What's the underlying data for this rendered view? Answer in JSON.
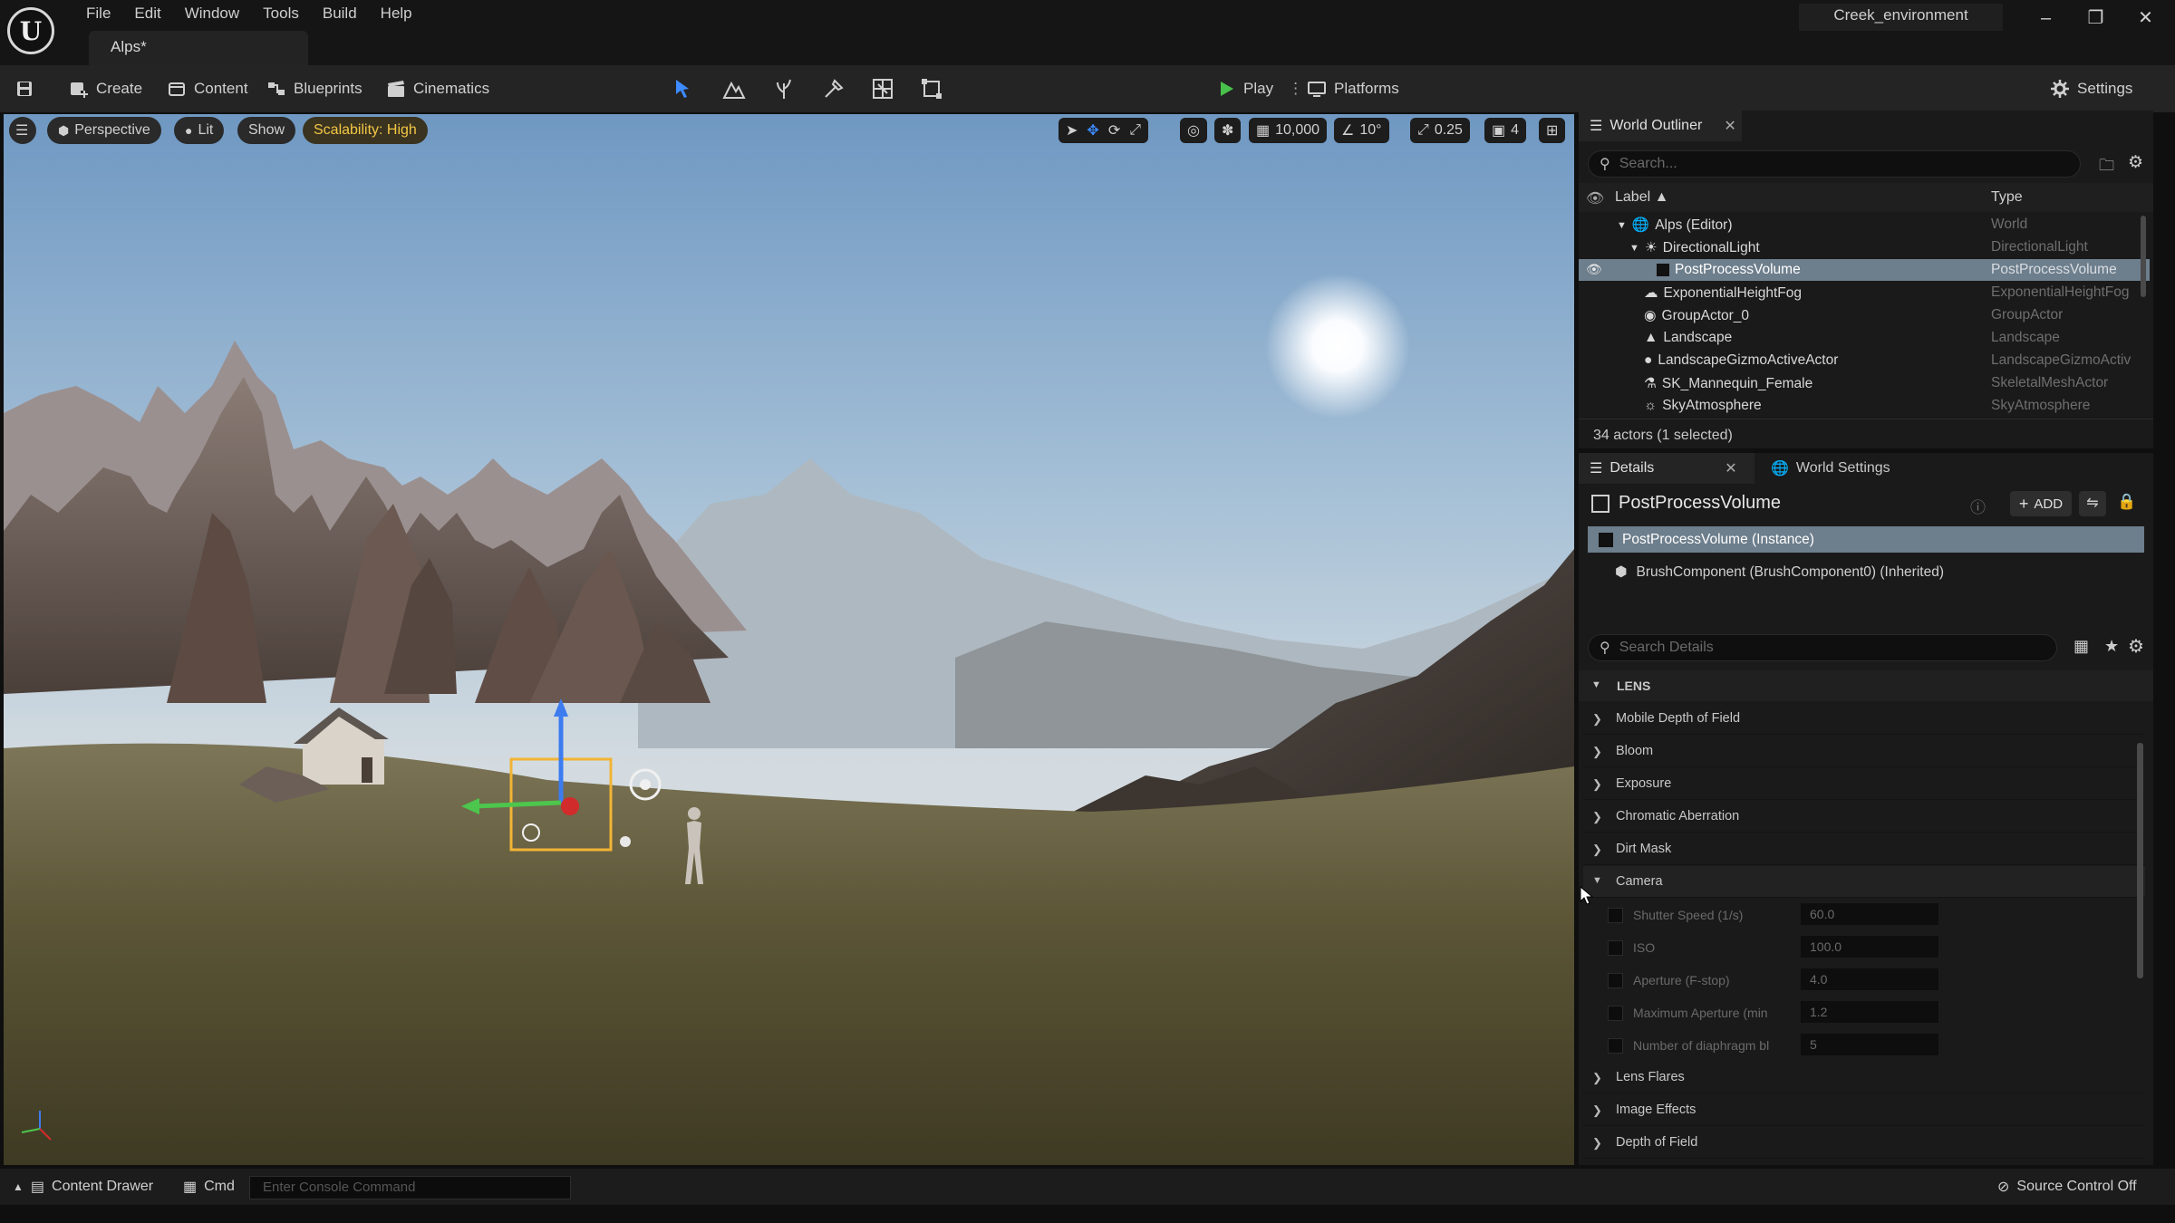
{
  "app": {
    "logo_text": "U",
    "menu": [
      "File",
      "Edit",
      "Window",
      "Tools",
      "Build",
      "Help"
    ],
    "project_name": "Creek_environment",
    "level_tab": "Alps*"
  },
  "toolbar": {
    "create": "Create",
    "content": "Content",
    "blueprints": "Blueprints",
    "cinematics": "Cinematics",
    "play": "Play",
    "platforms": "Platforms",
    "settings": "Settings"
  },
  "viewport": {
    "perspective": "Perspective",
    "lit": "Lit",
    "show": "Show",
    "scalability": "Scalability: High",
    "grid_snap": "10,000",
    "rotation_snap": "10°",
    "scale_snap": "0.25",
    "camera_speed": "4",
    "colors": {
      "accent": "#f3c745",
      "sky_top": "#7aa2c8",
      "ground": "#5a5433"
    }
  },
  "outliner": {
    "tab": "World Outliner",
    "search_placeholder": "Search...",
    "col_label": "Label",
    "col_type": "Type",
    "rows": [
      {
        "label": "Alps (Editor)",
        "type": "World"
      },
      {
        "label": "DirectionalLight",
        "type": "DirectionalLight"
      },
      {
        "label": "PostProcessVolume",
        "type": "PostProcessVolume"
      },
      {
        "label": "ExponentialHeightFog",
        "type": "ExponentialHeightFog"
      },
      {
        "label": "GroupActor_0",
        "type": "GroupActor"
      },
      {
        "label": "Landscape",
        "type": "Landscape"
      },
      {
        "label": "LandscapeGizmoActiveActor",
        "type": "LandscapeGizmoActiv"
      },
      {
        "label": "SK_Mannequin_Female",
        "type": "SkeletalMeshActor"
      },
      {
        "label": "SkyAtmosphere",
        "type": "SkyAtmosphere"
      }
    ],
    "footer": "34 actors (1 selected)"
  },
  "details": {
    "tab": "Details",
    "tab2": "World Settings",
    "object_name": "PostProcessVolume",
    "add_label": "ADD",
    "instance": "PostProcessVolume (Instance)",
    "component": "BrushComponent (BrushComponent0) (Inherited)",
    "search_placeholder": "Search Details",
    "section": "LENS",
    "groups": [
      "Mobile Depth of Field",
      "Bloom",
      "Exposure",
      "Chromatic Aberration",
      "Dirt Mask",
      "Camera"
    ],
    "camera_props": [
      {
        "name": "Shutter Speed (1/s)",
        "value": "60.0"
      },
      {
        "name": "ISO",
        "value": "100.0"
      },
      {
        "name": "Aperture (F-stop)",
        "value": "4.0"
      },
      {
        "name": "Maximum Aperture (min",
        "value": "1.2"
      },
      {
        "name": "Number of diaphragm bla",
        "value": "5"
      }
    ],
    "groups_after": [
      "Lens Flares",
      "Image Effects",
      "Depth of Field"
    ]
  },
  "statusbar": {
    "content_drawer": "Content Drawer",
    "cmd": "Cmd",
    "console_placeholder": "Enter Console Command",
    "source_control": "Source Control Off"
  }
}
